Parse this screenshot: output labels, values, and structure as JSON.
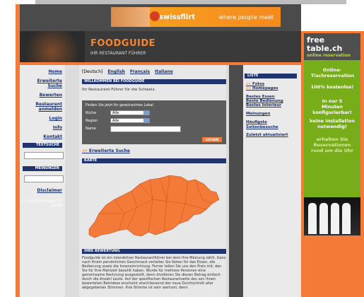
{
  "banner": {
    "logo": "swissflirt",
    "tagline": "where people meet"
  },
  "header": {
    "title": "FOODGUIDE",
    "subtitle": "IHR RESTAURANT FÜHRER"
  },
  "leftnav": {
    "items": [
      "Home",
      "Erweiterte Suche",
      "Bewerten",
      "Restaurant anmelden",
      "Login",
      "Info",
      "Kontakt"
    ],
    "textsuche": "TEXTSUCHE",
    "meinungen": "MEINUNGEN",
    "disclaimer": "Disclaimer",
    "copyright": "© 2001-2006 Publix ITC GmbH"
  },
  "main": {
    "languages": {
      "current": "[Deutsch]",
      "english": "English",
      "francais": "Français",
      "italiano": "Italiano"
    },
    "welcome_head": "WILLKOMMEN BEI FOODGUIDE",
    "welcome_text": "Ihr Restaurant-Führer für die Schweiz.",
    "form": {
      "hint": "Finden Sie jetzt Ihr gewünschtes Lokal.",
      "kueche_label": "Küche",
      "kueche_value": "Alle",
      "region_label": "Region",
      "region_value": "Alle",
      "name_label": "Name",
      "search_button": "SUCHEN"
    },
    "extended_search": "Erweiterte Suche",
    "map_head": "KARTE",
    "rating_head": "IHRE BEWERTUNG",
    "rating_text": "Foodguide ist ein interaktiver Restaurantführer bei dem Ihre Meinung zählt. Ganz nach Ihrem persönlichen Geschmack verteilen Sie Noten für das Essen, die Bedienung sowie die Inneneinrichtung. Ferner teilen Sie uns den Preis mit, den Sie für Ihre Mahlzeit bezahlt haben. Wurde für mehrere Personen eine gemeinsame Rechnung ausgestellt, dann dividieren Sie diesen Betrag einfach durch die Anzahl Leute. Auf der spezifischen Restaurantseite des von Ihnen bewerteten Betriebes erscheint anschliessend der neue Durchschnitt aller abgegebenen Stimmen. Ihre Stimme ist sehr wertvoll, denn"
  },
  "rightcol": {
    "list_head": "LISTE",
    "links": [
      "Fotos",
      "Homepages",
      "Bestes Essen",
      "Beste Bedienung",
      "Bestes Interieur",
      "Meinungen",
      "Häufigste Seitenbesuche",
      "Zuletzt aktualisiert"
    ]
  },
  "ad": {
    "brand_line1": "free",
    "brand_line2": "table.ch",
    "brand_line3": "online reservation",
    "text1": "Online-Tischreservation",
    "text2": "100% kostenlos!",
    "text3": "In nur 5 Minuten konfigurierbar!",
    "text4": "keine Installation notwendig!",
    "text5": "erhalten Sie Reservationen rund um die Uhr"
  },
  "colors": {
    "accent": "#f47a3a",
    "navy": "#22346e",
    "green": "#77ad19"
  }
}
